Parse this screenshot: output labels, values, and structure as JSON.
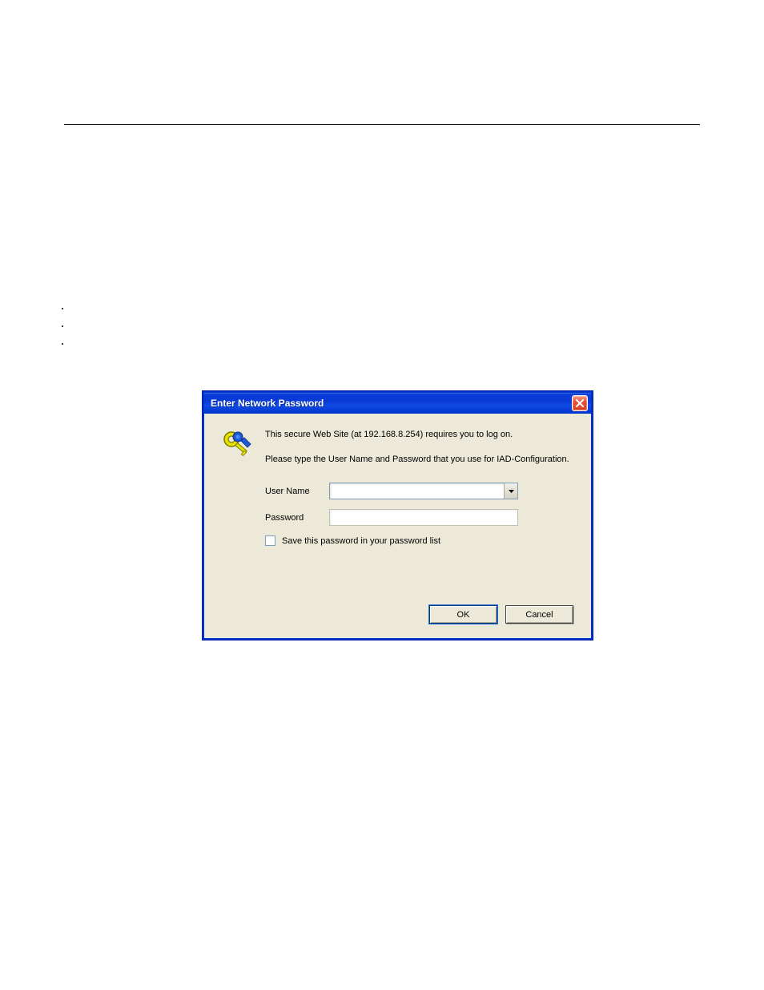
{
  "dialog": {
    "title": "Enter Network Password",
    "close_label": "X",
    "message1": "This secure Web Site (at 192.168.8.254) requires you to log on.",
    "message2": "Please type the User Name and Password that you use for IAD-Configuration.",
    "username_label": "User Name",
    "username_value": "",
    "password_label": "Password",
    "password_value": "",
    "save_checkbox_label": "Save this password in your password list",
    "save_checked": false,
    "ok_label": "OK",
    "cancel_label": "Cancel"
  },
  "icons": {
    "key": "key-icon",
    "close": "close-icon",
    "dropdown": "chevron-down-icon"
  }
}
